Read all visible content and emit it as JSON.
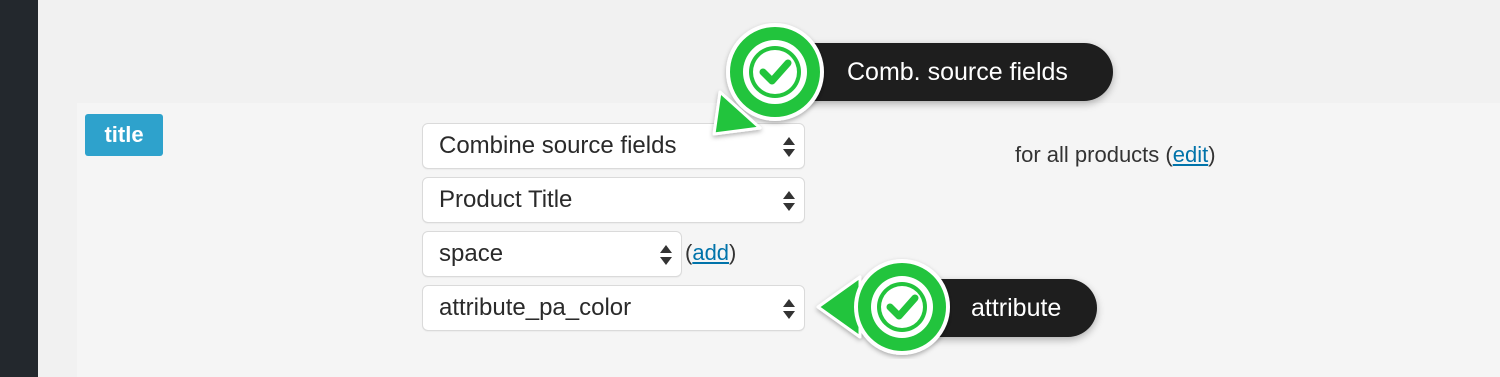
{
  "field_tag": {
    "label": "title"
  },
  "selects": {
    "source_type": "Combine source fields",
    "source_field": "Product Title",
    "separator": "space",
    "attribute": "attribute_pa_color"
  },
  "add_link": {
    "open": "(",
    "label": "add",
    "close": ")"
  },
  "scope": {
    "prefix": "for all products (",
    "edit_label": "edit",
    "suffix": ")"
  },
  "callouts": {
    "top": {
      "label": "Comb. source fields",
      "icon": "check-icon"
    },
    "bottom": {
      "label": "attribute",
      "icon": "check-icon"
    }
  },
  "colors": {
    "sidebar": "#23282d",
    "tag": "#2ea2cc",
    "link": "#0073aa",
    "check_green": "#22c43c",
    "callout_bg": "#1e1e1e"
  }
}
